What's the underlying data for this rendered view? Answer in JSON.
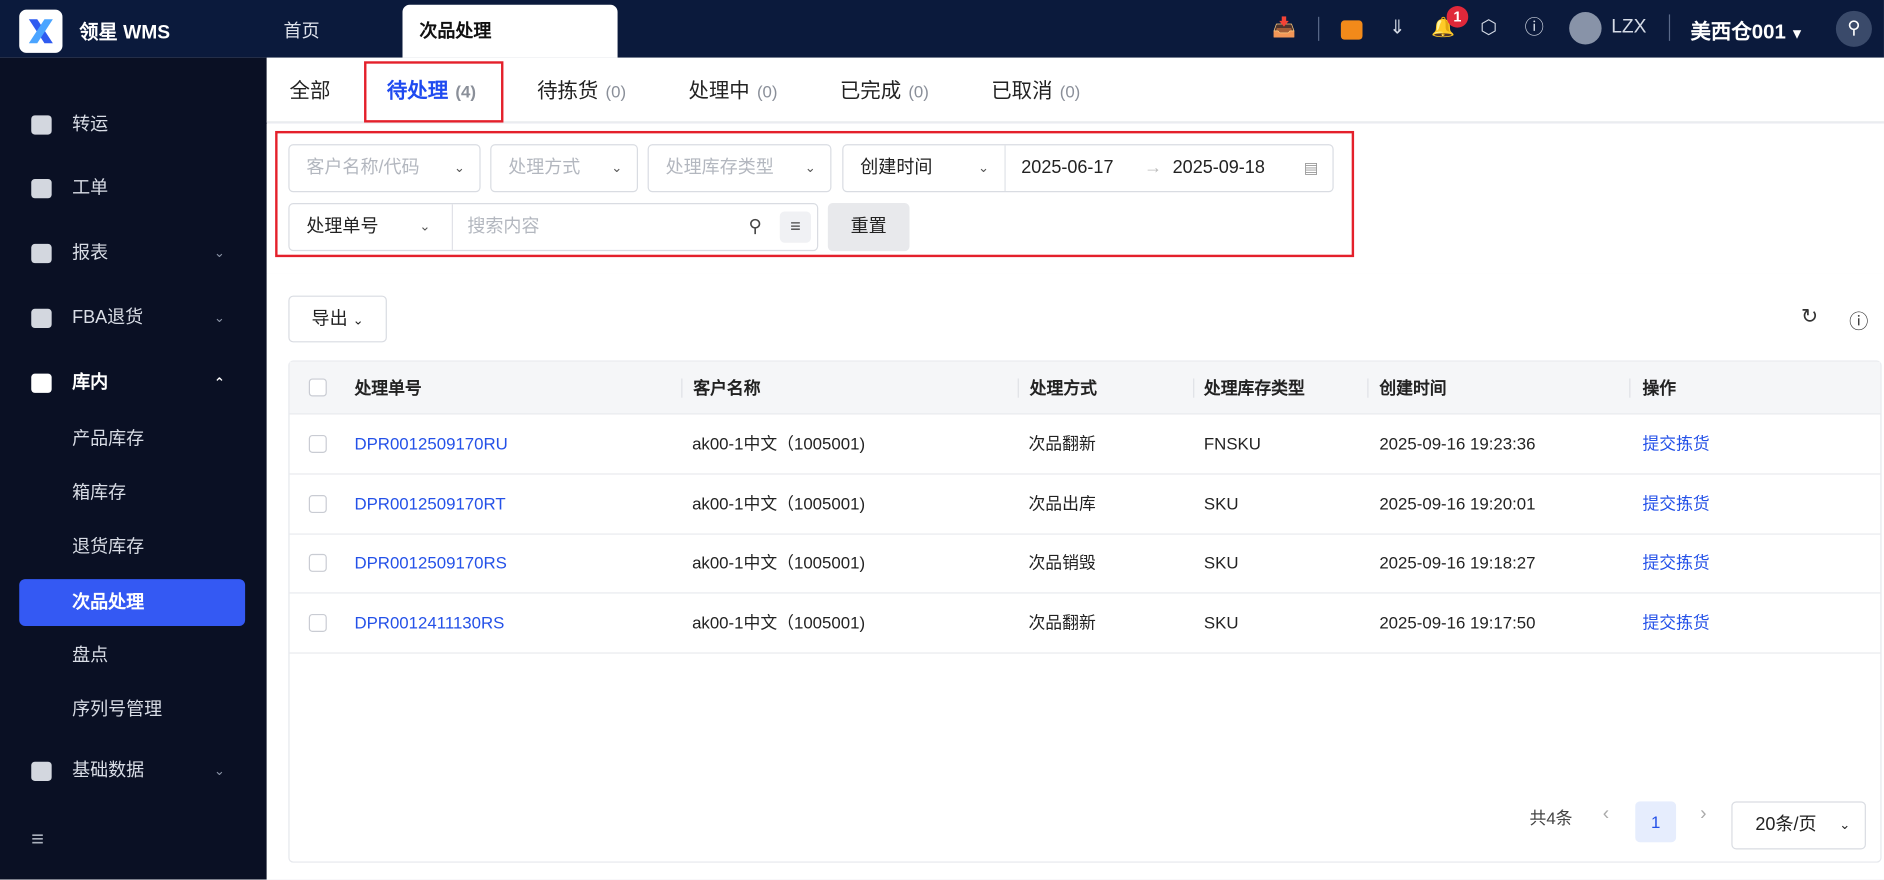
{
  "header": {
    "brand": "领星 WMS",
    "tabs": [
      {
        "label": "首页"
      },
      {
        "label": "次品处理"
      }
    ],
    "user": "LZX",
    "warehouse": "美西仓001",
    "notification_count": "1"
  },
  "sidebar": {
    "items": [
      {
        "label": "转运"
      },
      {
        "label": "工单"
      },
      {
        "label": "报表"
      },
      {
        "label": "FBA退货"
      },
      {
        "label": "库内"
      },
      {
        "label": "基础数据"
      }
    ],
    "sub_items": [
      {
        "label": "产品库存"
      },
      {
        "label": "箱库存"
      },
      {
        "label": "退货库存"
      },
      {
        "label": "次品处理"
      },
      {
        "label": "盘点"
      },
      {
        "label": "序列号管理"
      }
    ]
  },
  "status_tabs": [
    {
      "label": "全部",
      "count": ""
    },
    {
      "label": "待处理",
      "count": "(4)"
    },
    {
      "label": "待拣货",
      "count": "(0)"
    },
    {
      "label": "处理中",
      "count": "(0)"
    },
    {
      "label": "已完成",
      "count": "(0)"
    },
    {
      "label": "已取消",
      "count": "(0)"
    }
  ],
  "filters": {
    "customer_placeholder": "客户名称/代码",
    "method_placeholder": "处理方式",
    "stock_type_placeholder": "处理库存类型",
    "time_field": "创建时间",
    "date_start": "2025-06-17",
    "date_end": "2025-09-18",
    "search_field": "处理单号",
    "search_placeholder": "搜索内容",
    "reset": "重置"
  },
  "toolbar": {
    "export": "导出"
  },
  "table": {
    "columns": [
      "处理单号",
      "客户名称",
      "处理方式",
      "处理库存类型",
      "创建时间",
      "操作"
    ],
    "rows": [
      {
        "id": "DPR0012509170RU",
        "customer": "ak00-1中文（1005001)",
        "method": "次品翻新",
        "type": "FNSKU",
        "created": "2025-09-16 19:23:36",
        "action": "提交拣货"
      },
      {
        "id": "DPR0012509170RT",
        "customer": "ak00-1中文（1005001)",
        "method": "次品出库",
        "type": "SKU",
        "created": "2025-09-16 19:20:01",
        "action": "提交拣货"
      },
      {
        "id": "DPR0012509170RS",
        "customer": "ak00-1中文（1005001)",
        "method": "次品销毁",
        "type": "SKU",
        "created": "2025-09-16 19:18:27",
        "action": "提交拣货"
      },
      {
        "id": "DPR0012411130RS",
        "customer": "ak00-1中文（1005001)",
        "method": "次品翻新",
        "type": "SKU",
        "created": "2025-09-16 19:17:50",
        "action": "提交拣货"
      }
    ]
  },
  "pagination": {
    "total": "共4条",
    "page": "1",
    "page_size": "20条/页"
  },
  "colors": {
    "topbar": "#0b1a3c",
    "sidebar": "#0a1024",
    "accent": "#3459f3",
    "link": "#2451e8",
    "highlight": "#e4202b"
  }
}
